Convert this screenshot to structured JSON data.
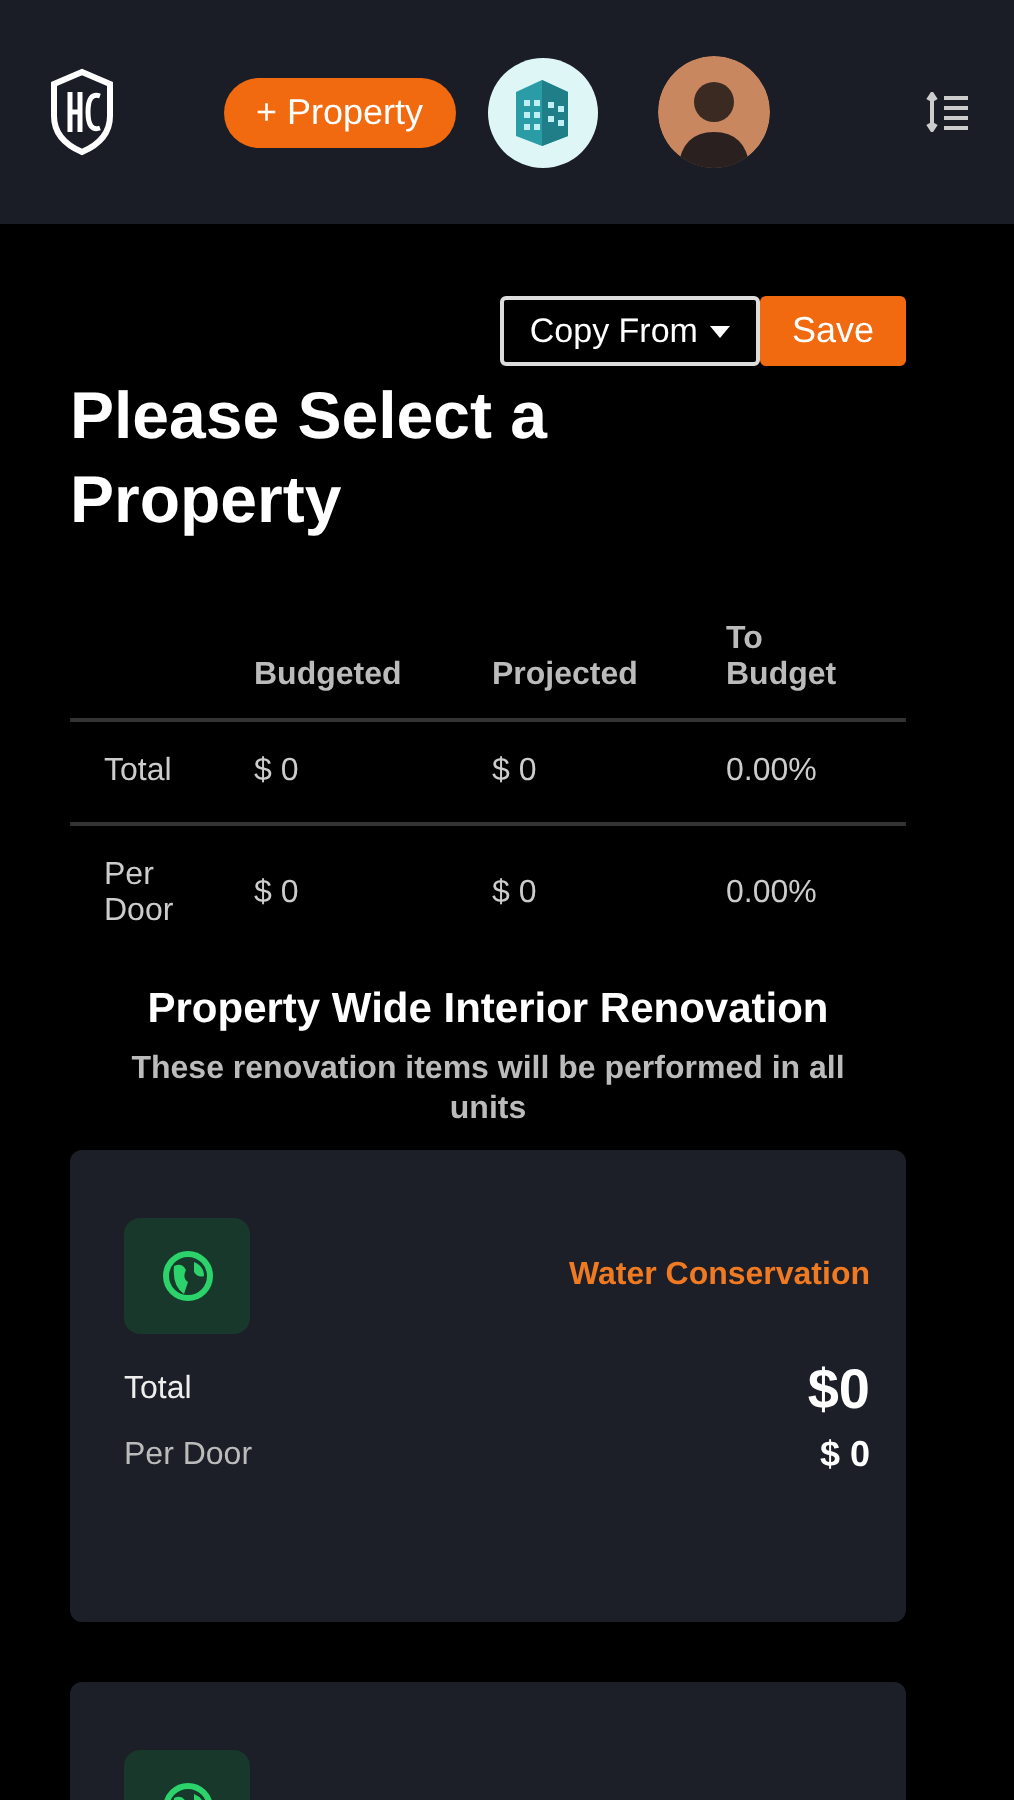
{
  "header": {
    "add_button": "+ Property"
  },
  "toolbar": {
    "copy_from": "Copy From",
    "save": "Save"
  },
  "title": "Please Select a Property",
  "summary": {
    "columns": [
      "Budgeted",
      "Projected",
      "To Budget"
    ],
    "rows": [
      {
        "label": "Total",
        "cells": [
          "$ 0",
          "$ 0",
          "0.00%"
        ]
      },
      {
        "label": "Per Door",
        "cells": [
          "$ 0",
          "$ 0",
          "0.00%"
        ]
      }
    ]
  },
  "section": {
    "heading": "Property Wide Interior Renovation",
    "subtitle": "These renovation items will be performed in all units"
  },
  "cards": [
    {
      "title": "Water Conservation",
      "total_label": "Total",
      "total": "$0",
      "per_door_label": "Per Door",
      "per_door": "$ 0"
    }
  ],
  "more_cards_below": true
}
